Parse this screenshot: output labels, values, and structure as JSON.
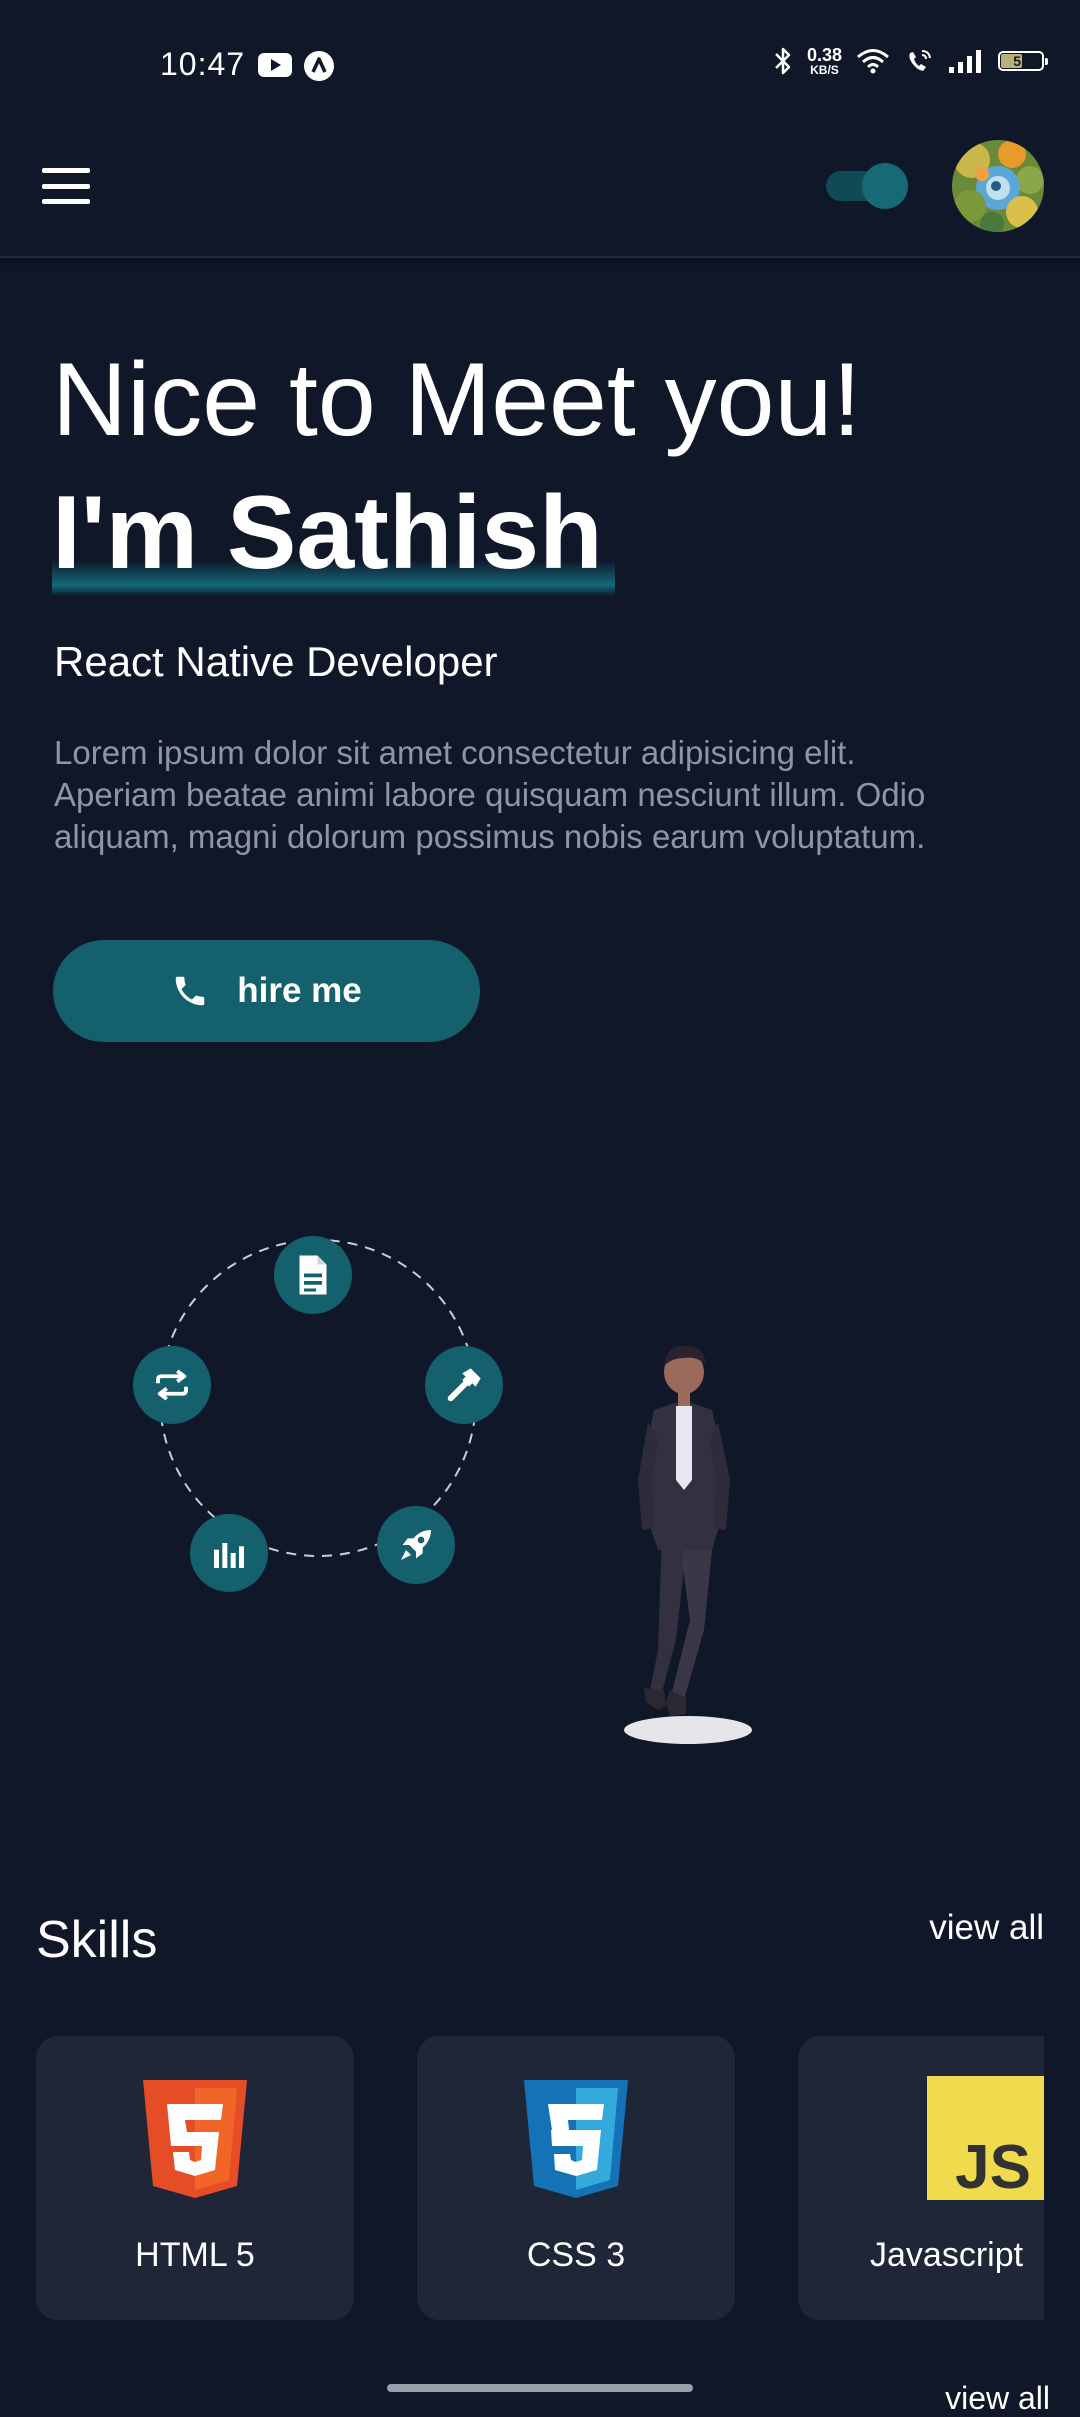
{
  "status_bar": {
    "time": "10:47",
    "net_speed_value": "0.38",
    "net_speed_unit": "KB/S",
    "battery_level": "51"
  },
  "header": {
    "menu_icon": "hamburger-menu-icon",
    "theme_toggle": "on",
    "avatar": "profile-avatar"
  },
  "hero": {
    "greeting": "Nice to Meet you!",
    "name": "I'm Sathish",
    "role": "React Native Developer",
    "description": "Lorem ipsum dolor sit amet consectetur adipisicing elit. Aperiam beatae animi labore quisquam nesciunt illum. Odio aliquam, magni dolorum possimus nobis earum voluptatum.",
    "hire_button_label": "hire me",
    "hire_button_icon": "phone-icon"
  },
  "illustration": {
    "orbit_icons": [
      "document-icon",
      "hammer-icon",
      "rocket-icon",
      "bar-chart-icon",
      "repeat-icon"
    ]
  },
  "skills": {
    "title": "Skills",
    "view_all_label": "view all",
    "items": [
      {
        "label": "HTML 5",
        "icon": "html5-icon"
      },
      {
        "label": "CSS 3",
        "icon": "css3-icon"
      },
      {
        "label": "Javascript",
        "icon": "javascript-icon"
      }
    ]
  },
  "partial_next_section_text": "view all",
  "colors": {
    "background": "#101729",
    "accent": "#14616d",
    "card": "#1e2638",
    "muted_text": "#8d96a6"
  }
}
